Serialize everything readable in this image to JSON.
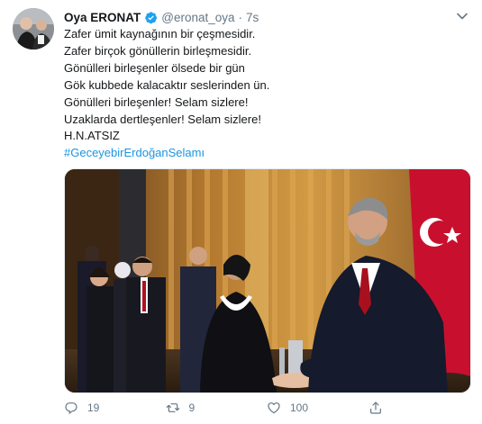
{
  "tweet": {
    "author_name": "Oya ERONAT",
    "handle": "@eronat_oya",
    "separator": "·",
    "time": "7s",
    "lines": [
      "Zafer ümit kaynağının bir çeşmesidir.",
      "Zafer birçok gönüllerin birleşmesidir.",
      "Gönülleri birleşenler ölsede bir gün",
      "Gök kubbede kalacaktır seslerinden ün.",
      "Gönülleri birleşenler! Selam sizlere!",
      "Uzaklarda dertleşenler! Selam sizlere!",
      "H.N.ATSIZ"
    ],
    "hashtag": "#GeceyebirErdoğanSelamı"
  },
  "actions": {
    "reply_count": "19",
    "retweet_count": "9",
    "like_count": "100"
  },
  "icons": {
    "verified": "verified-badge-icon",
    "caret": "chevron-down-icon",
    "reply": "reply-icon",
    "retweet": "retweet-icon",
    "like": "heart-icon",
    "share": "share-icon"
  },
  "colors": {
    "accent": "#1b95e0",
    "secondary_text": "#657786",
    "primary_text": "#14171a"
  }
}
